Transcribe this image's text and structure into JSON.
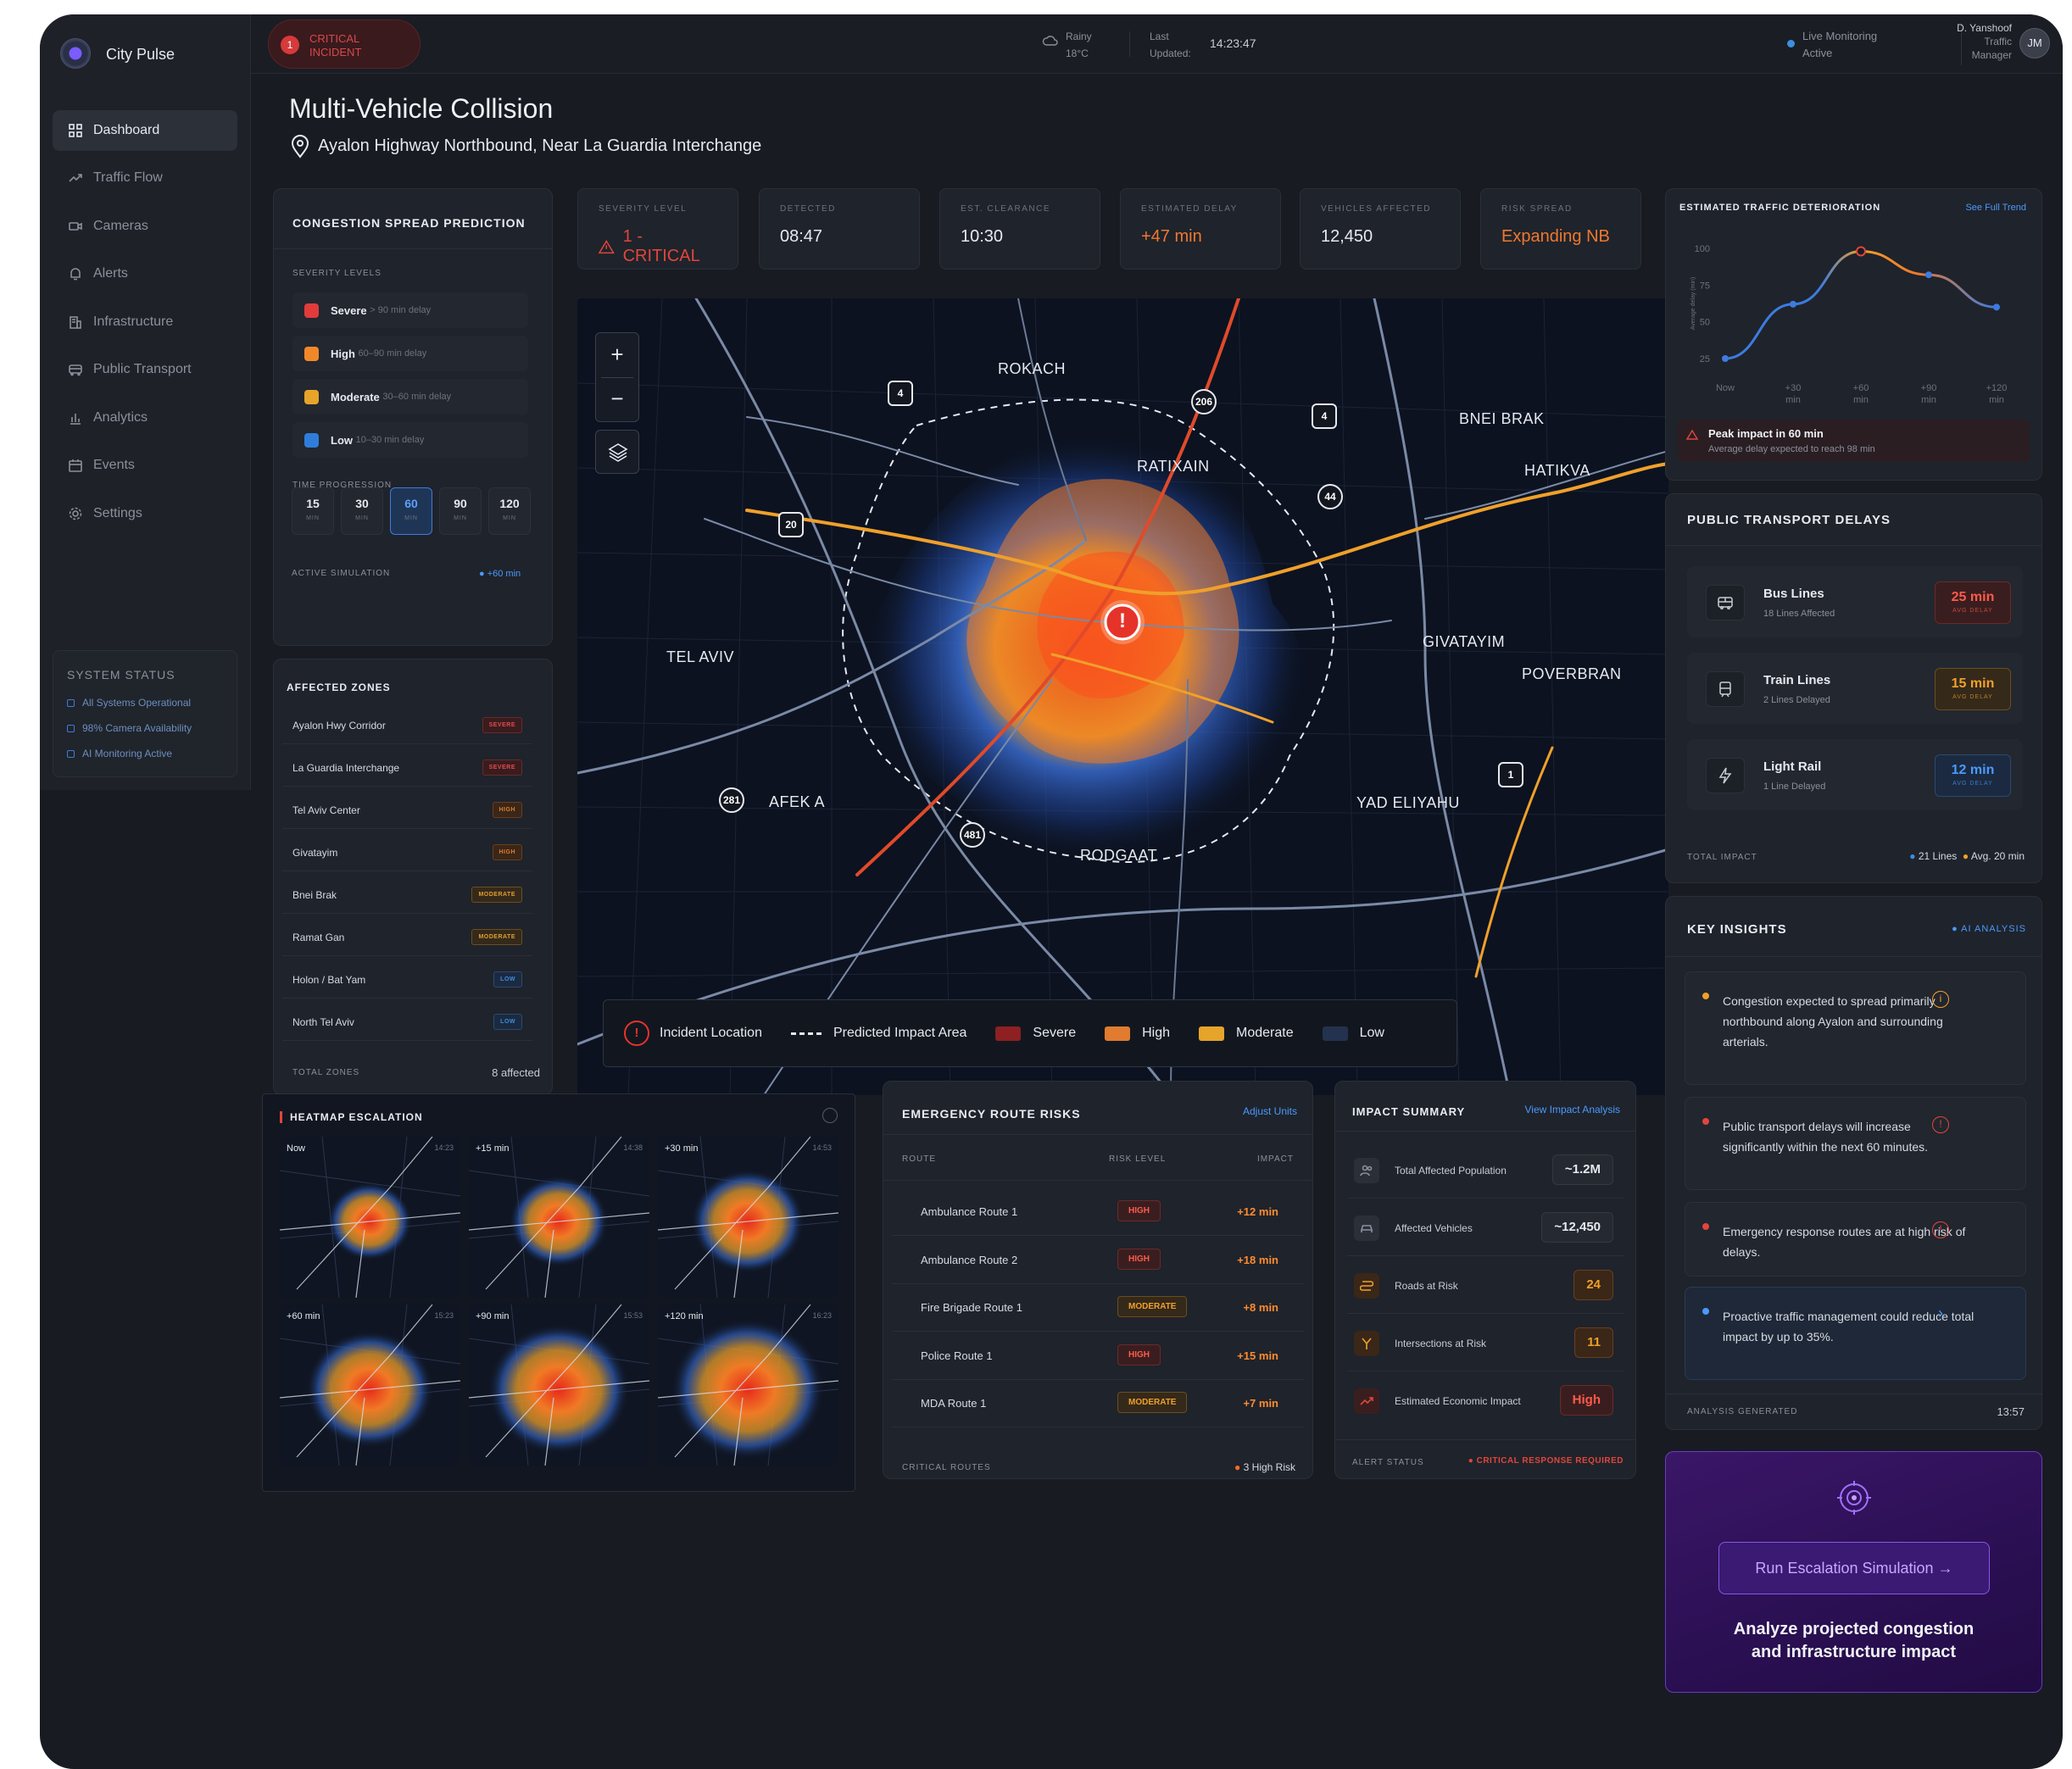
{
  "app": {
    "name": "City Pulse"
  },
  "topbar": {
    "incident_count": "1",
    "incident_text_line1": "CRITICAL",
    "incident_text_line2": "INCIDENT",
    "weather_cond": "Rainy",
    "weather_temp": "18°C",
    "last_label1": "Last",
    "last_label2": "Updated:",
    "last_time": "14:23:47",
    "live_line1": "Live Monitoring",
    "live_line2": "Active",
    "user_name": "D. Yanshoof",
    "user_role1": "Traffic",
    "user_role2": "Manager",
    "user_initials": "JM"
  },
  "sidebar": {
    "items": [
      {
        "label": "Dashboard",
        "icon": "grid-icon"
      },
      {
        "label": "Traffic Flow",
        "icon": "trend-icon"
      },
      {
        "label": "Cameras",
        "icon": "camera-icon"
      },
      {
        "label": "Alerts",
        "icon": "bell-icon"
      },
      {
        "label": "Infrastructure",
        "icon": "building-icon"
      },
      {
        "label": "Public Transport",
        "icon": "bus-icon"
      },
      {
        "label": "Analytics",
        "icon": "bar-chart-icon"
      },
      {
        "label": "Events",
        "icon": "calendar-icon"
      },
      {
        "label": "Settings",
        "icon": "gear-icon"
      }
    ],
    "system_status": {
      "title": "SYSTEM STATUS",
      "items": [
        "All Systems Operational",
        "98% Camera Availability",
        "AI Monitoring Active"
      ]
    }
  },
  "incident": {
    "title": "Multi-Vehicle Collision",
    "location": "Ayalon Highway Northbound, Near La Guardia Interchange"
  },
  "kpis": [
    {
      "label": "SEVERITY LEVEL",
      "value": "1 - CRITICAL"
    },
    {
      "label": "DETECTED",
      "value": "08:47"
    },
    {
      "label": "EST. CLEARANCE",
      "value": "10:30"
    },
    {
      "label": "ESTIMATED DELAY",
      "value": "+47 min"
    },
    {
      "label": "VEHICLES AFFECTED",
      "value": "12,450"
    },
    {
      "label": "RISK SPREAD",
      "value": "Expanding NB"
    }
  ],
  "congestion": {
    "title": "CONGESTION SPREAD PREDICTION",
    "levels_title": "SEVERITY LEVELS",
    "levels": [
      {
        "name": "Severe",
        "desc": "> 90 min delay",
        "color": "#e23b3b"
      },
      {
        "name": "High",
        "desc": "60–90 min delay",
        "color": "#f0882a"
      },
      {
        "name": "Moderate",
        "desc": "30–60 min delay",
        "color": "#e6a42b"
      },
      {
        "name": "Low",
        "desc": "10–30 min delay",
        "color": "#2f7ddb"
      }
    ],
    "time_title": "TIME PROGRESSION",
    "times": [
      {
        "n": "15",
        "u": "MIN"
      },
      {
        "n": "30",
        "u": "MIN"
      },
      {
        "n": "60",
        "u": "MIN"
      },
      {
        "n": "90",
        "u": "MIN"
      },
      {
        "n": "120",
        "u": "MIN"
      }
    ],
    "active_label": "ACTIVE SIMULATION",
    "active_value": "+60 min"
  },
  "zones": {
    "title": "AFFECTED ZONES",
    "items": [
      {
        "name": "Ayalon Hwy Corridor",
        "level": "SEVERE"
      },
      {
        "name": "La Guardia Interchange",
        "level": "SEVERE"
      },
      {
        "name": "Tel Aviv Center",
        "level": "HIGH"
      },
      {
        "name": "Givatayim",
        "level": "HIGH"
      },
      {
        "name": "Bnei Brak",
        "level": "MODERATE"
      },
      {
        "name": "Ramat Gan",
        "level": "MODERATE"
      },
      {
        "name": "Holon / Bat Yam",
        "level": "LOW"
      },
      {
        "name": "North Tel Aviv",
        "level": "LOW"
      }
    ],
    "total_label": "TOTAL ZONES",
    "total_value": "8 affected"
  },
  "map": {
    "labels": [
      "ROKACH",
      "BNEI BRAK",
      "RATIXAIN",
      "HATIKVA",
      "TEL AVIV",
      "GIVATAYIM",
      "POVERBRAN",
      "AFEK A",
      "YAD ELIYAHU",
      "RODGAAT"
    ],
    "shields": [
      "4",
      "206",
      "4",
      "44",
      "20",
      "281",
      "481",
      "1"
    ],
    "zoom_in": "+",
    "zoom_out": "−",
    "incident_mark": "!",
    "legend": {
      "incident": "Incident Location",
      "impact": "Predicted Impact Area",
      "severe": "Severe",
      "high": "High",
      "moderate": "Moderate",
      "low": "Low"
    }
  },
  "deterioration": {
    "title": "ESTIMATED TRAFFIC DETERIORATION",
    "link": "See Full Trend",
    "peak_title": "Peak impact in 60 min",
    "peak_desc": "Average delay expected to reach 98 min",
    "chart_data": {
      "type": "line",
      "x": [
        "Now",
        "+30 min",
        "+60 min",
        "+90 min",
        "+120 min"
      ],
      "y_ticks": [
        100,
        75,
        50,
        25
      ],
      "ylabel": "Average delay (min)",
      "ylim": [
        25,
        100
      ],
      "series": [
        {
          "values": [
            25,
            62,
            98,
            82,
            60
          ]
        }
      ]
    }
  },
  "transport": {
    "title": "PUBLIC TRANSPORT DELAYS",
    "items": [
      {
        "name": "Bus Lines",
        "sub": "18 Lines Affected",
        "value": "25 min",
        "unit": "AVG DELAY",
        "color": "#ff5a4a"
      },
      {
        "name": "Train Lines",
        "sub": "2 Lines Delayed",
        "value": "15 min",
        "unit": "AVG DELAY",
        "color": "#f0a02a"
      },
      {
        "name": "Light Rail",
        "sub": "1 Line Delayed",
        "value": "12 min",
        "unit": "AVG DELAY",
        "color": "#4a9aff"
      }
    ],
    "total_label": "TOTAL IMPACT",
    "total_lines": "21 Lines",
    "total_avg": "Avg. 20 min"
  },
  "insights": {
    "title": "KEY INSIGHTS",
    "tag": "AI ANALYSIS",
    "items": [
      "Congestion expected to spread primarily northbound along Ayalon and surrounding arterials.",
      "Public transport delays will increase significantly within the next 60 minutes.",
      "Emergency response routes are at high risk of delays.",
      "Proactive traffic management could reduce total impact by up to 35%."
    ],
    "generated_label": "ANALYSIS GENERATED",
    "generated_time": "13:57"
  },
  "simulation": {
    "button": "Run Escalation Simulation",
    "caption_line1": "Analyze projected congestion",
    "caption_line2": "and infrastructure impact"
  },
  "heatmap": {
    "title": "HEATMAP ESCALATION",
    "frames": [
      {
        "label": "Now",
        "time": "14:23"
      },
      {
        "label": "+15 min",
        "time": "14:38"
      },
      {
        "label": "+30 min",
        "time": "14:53"
      },
      {
        "label": "+60 min",
        "time": "15:23"
      },
      {
        "label": "+90 min",
        "time": "15:53"
      },
      {
        "label": "+120 min",
        "time": "16:23"
      }
    ]
  },
  "routes": {
    "title": "EMERGENCY ROUTE RISKS",
    "link": "Adjust Units",
    "headers": [
      "ROUTE",
      "RISK LEVEL",
      "IMPACT"
    ],
    "rows": [
      {
        "route": "Ambulance Route 1",
        "risk": "HIGH",
        "impact": "+12 min"
      },
      {
        "route": "Ambulance Route 2",
        "risk": "HIGH",
        "impact": "+18 min"
      },
      {
        "route": "Fire Brigade Route 1",
        "risk": "MODERATE",
        "impact": "+8 min"
      },
      {
        "route": "Police Route 1",
        "risk": "HIGH",
        "impact": "+15 min"
      },
      {
        "route": "MDA Route 1",
        "risk": "MODERATE",
        "impact": "+7 min"
      }
    ],
    "footer_label": "CRITICAL ROUTES",
    "footer_value": "3 High Risk"
  },
  "impact": {
    "title": "IMPACT SUMMARY",
    "link": "View Impact Analysis",
    "rows": [
      {
        "label": "Total Affected Population",
        "value": "~1.2M"
      },
      {
        "label": "Affected Vehicles",
        "value": "~12,450"
      },
      {
        "label": "Roads at Risk",
        "value": "24"
      },
      {
        "label": "Intersections at Risk",
        "value": "11"
      },
      {
        "label": "Estimated Economic Impact",
        "value": "High"
      }
    ],
    "alert_label": "ALERT STATUS",
    "alert_value": "CRITICAL RESPONSE REQUIRED"
  }
}
